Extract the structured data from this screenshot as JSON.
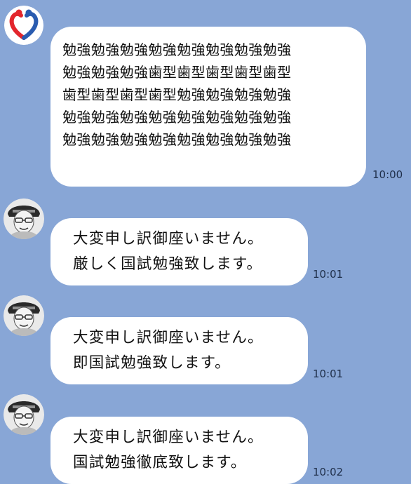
{
  "colors": {
    "background": "#88a6d6",
    "bubble": "#ffffff",
    "text": "#111111",
    "timestamp": "#1f2f4a",
    "logo_red": "#e3262d",
    "logo_blue": "#2a5cb0"
  },
  "messages": [
    {
      "sender_avatar": "heart-people-logo-icon",
      "lines": [
        "勉強勉強勉強勉強勉強勉強勉強勉強",
        "勉強勉強勉強歯型歯型歯型歯型歯型",
        "歯型歯型歯型歯型勉強勉強勉強勉強",
        "勉強勉強勉強勉強勉強勉強勉強勉強",
        "勉強勉強勉強勉強勉強勉強勉強勉強"
      ],
      "time": "10:00"
    },
    {
      "sender_avatar": "person-avatar-icon",
      "lines": [
        "大変申し訳御座いません。",
        "厳しく国試勉強致します。"
      ],
      "time": "10:01"
    },
    {
      "sender_avatar": "person-avatar-icon",
      "lines": [
        "大変申し訳御座いません。",
        "即国試勉強致します。"
      ],
      "time": "10:01"
    },
    {
      "sender_avatar": "person-avatar-icon",
      "lines": [
        "大変申し訳御座いません。",
        "国試勉強徹底致します。"
      ],
      "time": "10:02"
    }
  ]
}
